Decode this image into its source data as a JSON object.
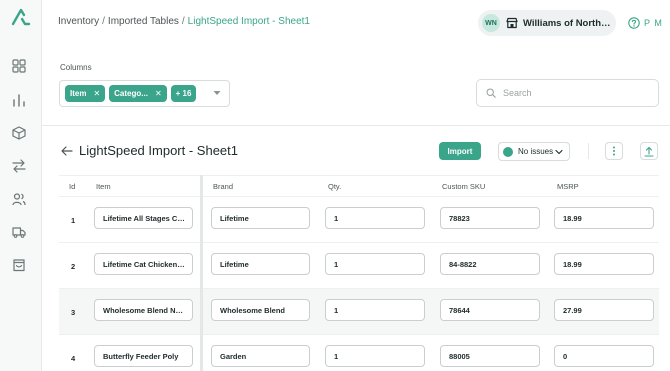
{
  "header": {
    "breadcrumb": [
      "Inventory",
      "Imported Tables",
      "LightSpeed Import - Sheet1"
    ],
    "breadcrumb_separator": "/",
    "store": {
      "initials": "WN",
      "name": "Williams of Northam..."
    },
    "help_label": "P M"
  },
  "sidebar": {
    "icons": [
      "logo-icon",
      "dashboard-grid-icon",
      "analytics-icon",
      "box-icon",
      "transfer-icon",
      "users-icon",
      "truck-icon",
      "bag-icon"
    ]
  },
  "filters": {
    "columns_label": "Columns",
    "chips": [
      "Item",
      "Catego..."
    ],
    "more_chip": "+ 16",
    "search_placeholder": "Search"
  },
  "toolbar": {
    "title": "LightSpeed Import - Sheet1",
    "import_label": "Import",
    "issues_label": "No issues"
  },
  "table": {
    "headers": [
      "Id",
      "Item",
      "Brand",
      "Qty.",
      "Custom SKU",
      "MSRP"
    ],
    "rows": [
      {
        "id": "1",
        "item": "Lifetime All Stages Cat ...",
        "brand": "Lifetime",
        "qty": "1",
        "sku": "78823",
        "msrp": "18.99"
      },
      {
        "id": "2",
        "item": "Lifetime Cat Chicken T...",
        "brand": "Lifetime",
        "qty": "1",
        "sku": "84-8822",
        "msrp": "18.99"
      },
      {
        "id": "3",
        "item": "Wholesome Blend Nat...",
        "brand": "Wholesome Blend",
        "qty": "1",
        "sku": "78644",
        "msrp": "27.99"
      },
      {
        "id": "4",
        "item": "Butterfly Feeder Poly",
        "brand": "Garden",
        "qty": "1",
        "sku": "88005",
        "msrp": "0"
      }
    ]
  },
  "colors": {
    "accent": "#3aa58a",
    "sidebar_bg": "#f7f8f8",
    "text": "#1f2a2a"
  }
}
